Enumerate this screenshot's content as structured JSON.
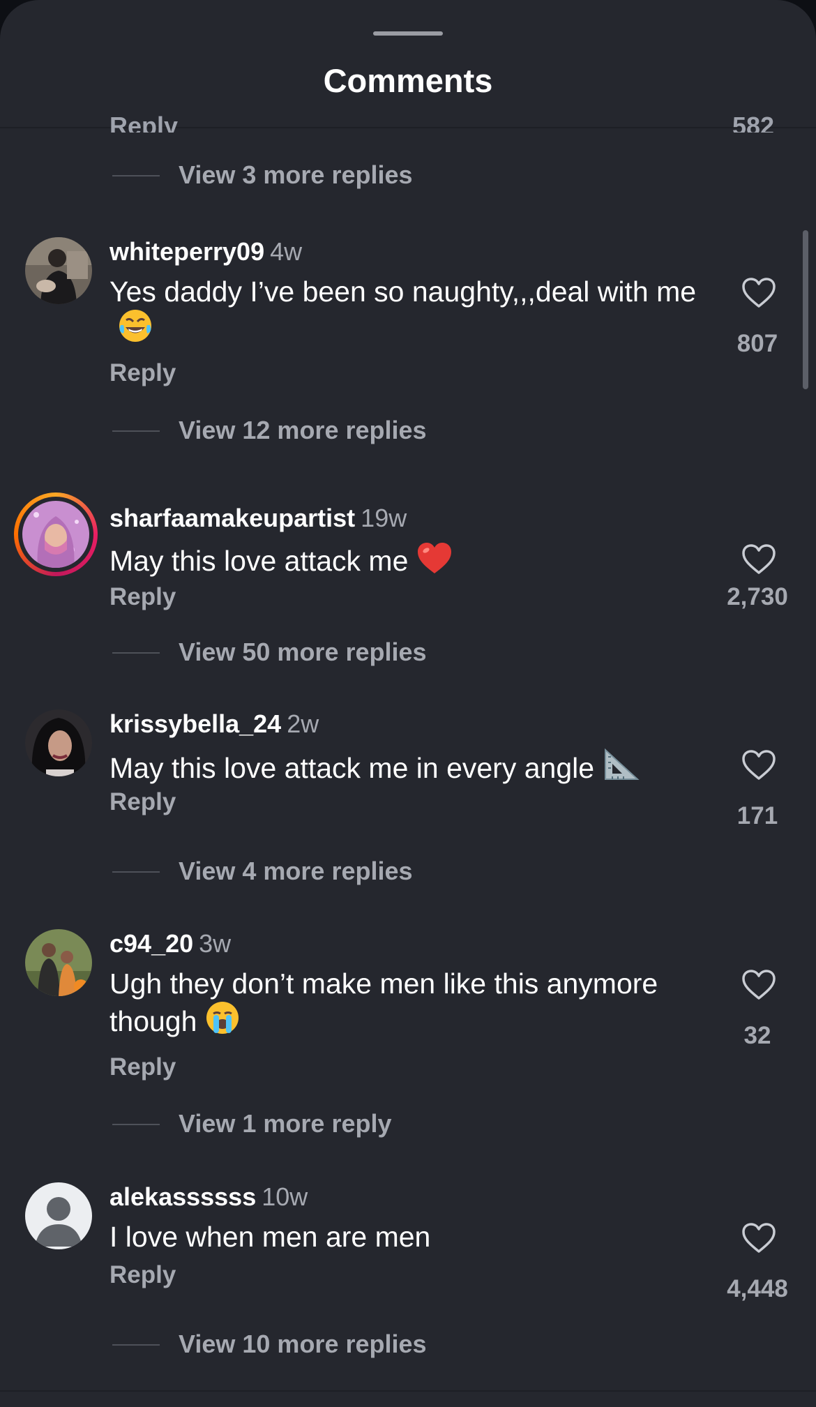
{
  "sheet": {
    "title": "Comments",
    "partial_reply_label": "Reply",
    "partial_likes": "582",
    "top_view_more": "View 3 more replies"
  },
  "comments": [
    {
      "username": "whiteperry09",
      "time": "4w",
      "text": "Yes daddy I’ve been so naughty,,,deal with me",
      "emoji": "face-with-tears-of-joy",
      "reply_label": "Reply",
      "likes": "807",
      "view_more": "View 12 more replies"
    },
    {
      "username": "sharfaamakeupartist",
      "time": "19w",
      "text": "May this love attack me",
      "emoji": "red-heart",
      "reply_label": "Reply",
      "likes": "2,730",
      "view_more": "View 50 more replies",
      "story_ring": true
    },
    {
      "username": "krissybella_24",
      "time": "2w",
      "text": "May this love attack me in every angle",
      "emoji": "triangular-ruler",
      "reply_label": "Reply",
      "likes": "171",
      "view_more": "View 4 more replies"
    },
    {
      "username": "c94_20",
      "time": "3w",
      "text": "Ugh they don’t make men like this anymore though",
      "emoji": "loudly-crying-face",
      "reply_label": "Reply",
      "likes": "32",
      "view_more": "View 1 more reply"
    },
    {
      "username": "alekassssss",
      "time": "10w",
      "text": "I love when men are men",
      "emoji": "",
      "reply_label": "Reply",
      "likes": "4,448",
      "view_more": "View 10 more replies",
      "default_avatar": true
    }
  ],
  "colors": {
    "sheet_bg": "#25272e",
    "text_primary": "#ffffff",
    "text_secondary": "#a6a9b1"
  }
}
